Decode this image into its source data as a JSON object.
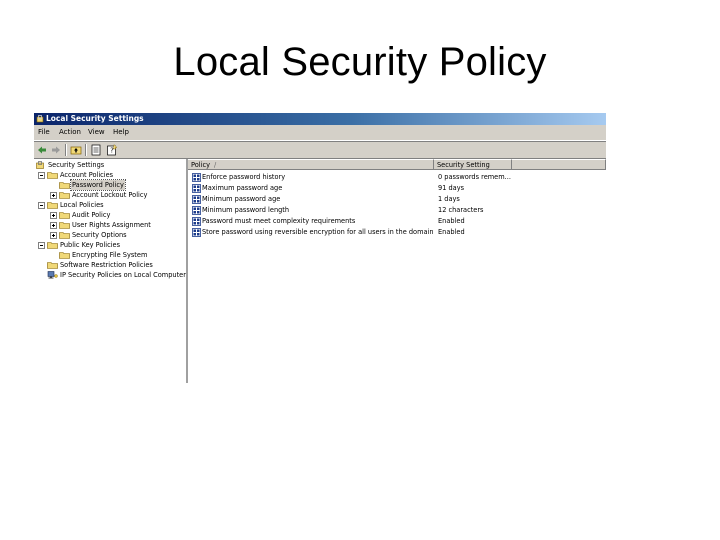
{
  "slide": {
    "title": "Local Security Policy"
  },
  "window": {
    "title": "Local Security Settings",
    "menu": [
      "File",
      "Action",
      "View",
      "Help"
    ],
    "toolbar_icons": [
      "back-arrow-icon",
      "forward-arrow-icon",
      "up-folder-icon",
      "export-list-icon",
      "help-icon"
    ]
  },
  "tree": {
    "items": [
      {
        "label": "Security Settings",
        "level": 0,
        "icon": "security-settings-icon"
      },
      {
        "label": "Account Policies",
        "level": 1,
        "icon": "folder-icon",
        "expanded": true
      },
      {
        "label": "Password Policy",
        "level": 2,
        "icon": "folder-icon",
        "selected": true
      },
      {
        "label": "Account Lockout Policy",
        "level": 2,
        "icon": "folder-icon",
        "expandable": true
      },
      {
        "label": "Local Policies",
        "level": 1,
        "icon": "folder-icon",
        "expanded": true
      },
      {
        "label": "Audit Policy",
        "level": 2,
        "icon": "folder-icon",
        "expandable": true
      },
      {
        "label": "User Rights Assignment",
        "level": 2,
        "icon": "folder-icon",
        "expandable": true
      },
      {
        "label": "Security Options",
        "level": 2,
        "icon": "folder-icon",
        "expandable": true
      },
      {
        "label": "Public Key Policies",
        "level": 1,
        "icon": "folder-icon",
        "expanded": true
      },
      {
        "label": "Encrypting File System",
        "level": 2,
        "icon": "folder-icon"
      },
      {
        "label": "Software Restriction Policies",
        "level": 1,
        "icon": "folder-icon"
      },
      {
        "label": "IP Security Policies on Local Computer",
        "level": 1,
        "icon": "ip-security-icon"
      }
    ]
  },
  "list": {
    "columns": [
      "Policy",
      "Security Setting"
    ],
    "sort_indicator": "/",
    "rows": [
      {
        "policy": "Enforce password history",
        "setting": "0 passwords remem..."
      },
      {
        "policy": "Maximum password age",
        "setting": "91 days"
      },
      {
        "policy": "Minimum password age",
        "setting": "1 days"
      },
      {
        "policy": "Minimum password length",
        "setting": "12 characters"
      },
      {
        "policy": "Password must meet complexity requirements",
        "setting": "Enabled"
      },
      {
        "policy": "Store password using reversible encryption for all users in the domain",
        "setting": "Enabled"
      }
    ]
  },
  "colors": {
    "titlebar_start": "#0a246a",
    "titlebar_end": "#a6caf0",
    "chrome": "#d4d0c8",
    "folder": "#f0d878"
  }
}
